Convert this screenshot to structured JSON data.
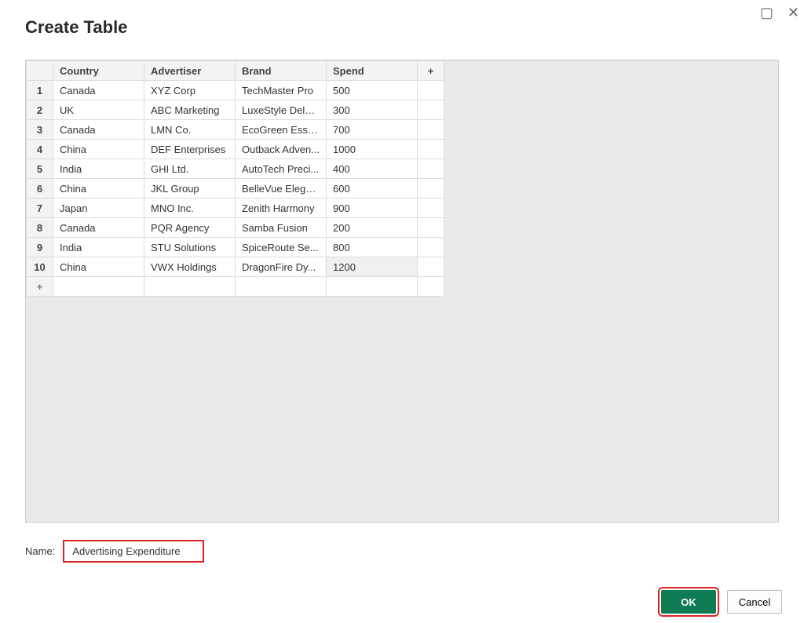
{
  "window": {
    "title": "Create Table",
    "maximize_glyph": "▢",
    "close_glyph": "✕"
  },
  "table": {
    "columns": [
      "Country",
      "Advertiser",
      "Brand",
      "Spend"
    ],
    "add_col_glyph": "+",
    "add_row_glyph": "+",
    "rows": [
      {
        "n": "1",
        "country": "Canada",
        "advertiser": "XYZ Corp",
        "brand": "TechMaster Pro",
        "spend": "500"
      },
      {
        "n": "2",
        "country": "UK",
        "advertiser": "ABC Marketing",
        "brand": "LuxeStyle Deluxe",
        "spend": "300"
      },
      {
        "n": "3",
        "country": "Canada",
        "advertiser": "LMN Co.",
        "brand": "EcoGreen Esse...",
        "spend": "700"
      },
      {
        "n": "4",
        "country": "China",
        "advertiser": "DEF Enterprises",
        "brand": "Outback Adven...",
        "spend": "1000"
      },
      {
        "n": "5",
        "country": "India",
        "advertiser": "GHI Ltd.",
        "brand": "AutoTech Preci...",
        "spend": "400"
      },
      {
        "n": "6",
        "country": "China",
        "advertiser": "JKL Group",
        "brand": "BelleVue Elega...",
        "spend": "600"
      },
      {
        "n": "7",
        "country": "Japan",
        "advertiser": "MNO Inc.",
        "brand": "Zenith Harmony",
        "spend": "900"
      },
      {
        "n": "8",
        "country": "Canada",
        "advertiser": "PQR Agency",
        "brand": "Samba Fusion",
        "spend": "200"
      },
      {
        "n": "9",
        "country": "India",
        "advertiser": "STU Solutions",
        "brand": "SpiceRoute Se...",
        "spend": "800"
      },
      {
        "n": "10",
        "country": "China",
        "advertiser": "VWX Holdings",
        "brand": "DragonFire Dy...",
        "spend": "1200"
      }
    ]
  },
  "name_field": {
    "label": "Name:",
    "value": "Advertising Expenditure"
  },
  "buttons": {
    "ok": "OK",
    "cancel": "Cancel"
  }
}
